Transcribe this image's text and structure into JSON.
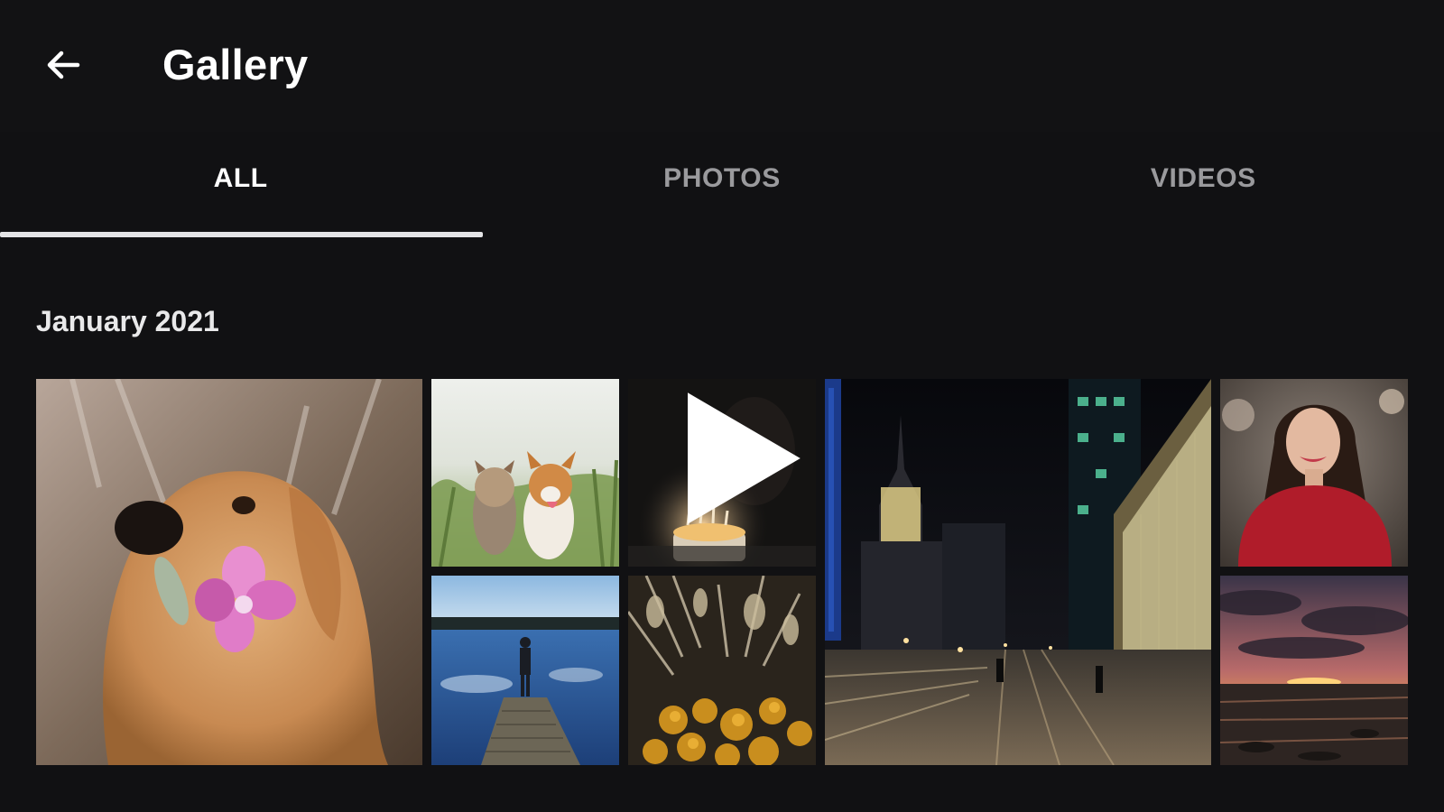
{
  "app_bar": {
    "title": "Gallery",
    "back_icon": "arrow-left-icon"
  },
  "tabs": [
    {
      "label": "ALL",
      "active": true
    },
    {
      "label": "PHOTOS",
      "active": false
    },
    {
      "label": "VIDEOS",
      "active": false
    }
  ],
  "sections": [
    {
      "header": "January 2021",
      "items": [
        {
          "type": "photo",
          "subject": "golden retriever holding pink flower"
        },
        {
          "type": "photo",
          "subject": "two small dogs in grass"
        },
        {
          "type": "video",
          "subject": "person blowing out birthday candles",
          "overlay_icon": "play-icon"
        },
        {
          "type": "photo",
          "subject": "city street at night with skyscraper"
        },
        {
          "type": "photo",
          "subject": "smiling woman in red sweater"
        },
        {
          "type": "photo",
          "subject": "person standing on pier over lake"
        },
        {
          "type": "photo",
          "subject": "dried flowers close-up"
        },
        {
          "type": "photo",
          "subject": "sunset over beach"
        }
      ]
    }
  ],
  "colors": {
    "background": "#111113",
    "app_bar": "#121214",
    "active_tab": "#ffffff",
    "inactive_tab": "#9a9a9d",
    "indicator": "#e4e4e6"
  }
}
